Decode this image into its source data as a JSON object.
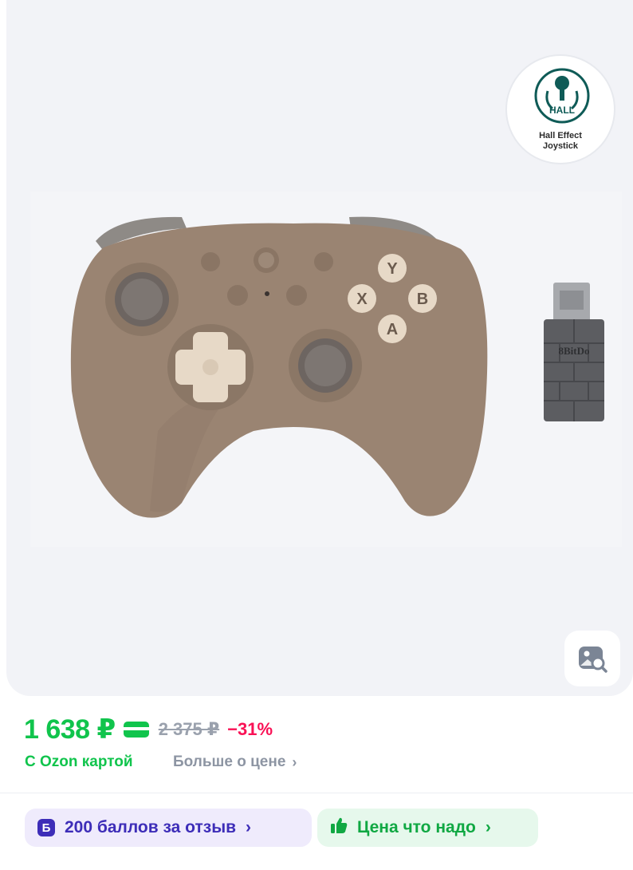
{
  "gallery": {
    "badge": {
      "icon_text": "HALL",
      "caption_line1": "Hall Effect",
      "caption_line2": "Joystick"
    },
    "product": {
      "adapter_brand": "8BitDo",
      "buttons": [
        "Y",
        "X",
        "B",
        "A"
      ]
    },
    "image_search_icon": "image-search-icon"
  },
  "price": {
    "current": "1 638 ₽",
    "old": "2 375 ₽",
    "discount": "−31%",
    "card_note": "С Ozon картой",
    "more_link": "Больше о цене",
    "chevron": "›"
  },
  "promos": {
    "points_icon_letter": "Б",
    "points_label": "200 баллов за отзыв",
    "price_label": "Цена что надо",
    "chevron": "›"
  },
  "colors": {
    "price_green": "#10c44c",
    "discount_red": "#f91155",
    "points_purple": "#3d2db8",
    "muted_gray": "#8d95a3"
  }
}
